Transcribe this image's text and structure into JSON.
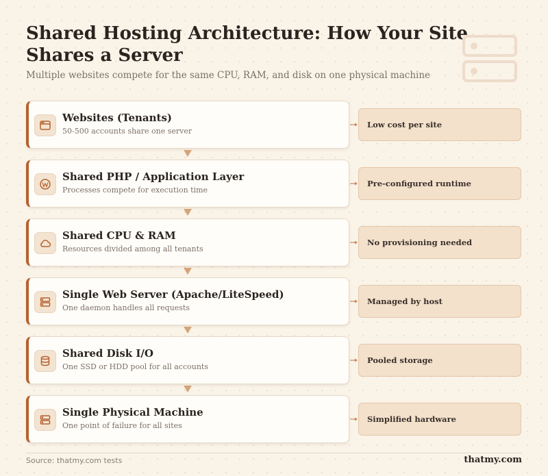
{
  "title": "Shared Hosting Architecture: How Your Site Shares a Server",
  "subtitle": "Multiple websites compete for the same CPU, RAM, and disk on one physical machine",
  "layers": [
    {
      "title": "Websites (Tenants)",
      "desc": "50-500 accounts share one server",
      "note": "Low cost per site",
      "icon": "browser-window-icon"
    },
    {
      "title": "Shared PHP / Application Layer",
      "desc": "Processes compete for execution time",
      "note": "Pre-configured runtime",
      "icon": "wordpress-icon"
    },
    {
      "title": "Shared CPU & RAM",
      "desc": "Resources divided among all tenants",
      "note": "No provisioning needed",
      "icon": "cloud-icon"
    },
    {
      "title": "Single Web Server (Apache/LiteSpeed)",
      "desc": "One daemon handles all requests",
      "note": "Managed by host",
      "icon": "server-icon"
    },
    {
      "title": "Shared Disk I/O",
      "desc": "One SSD or HDD pool for all accounts",
      "note": "Pooled storage",
      "icon": "database-icon"
    },
    {
      "title": "Single Physical Machine",
      "desc": "One point of failure for all sites",
      "note": "Simplified hardware",
      "icon": "server-icon"
    }
  ],
  "footer": {
    "source": "Source: thatmy.com tests",
    "brand": "thatmy.com"
  },
  "colors": {
    "accent": "#b4622e",
    "background": "#faf3e8",
    "card": "#fffdf9",
    "note": "#f3e1cc"
  }
}
